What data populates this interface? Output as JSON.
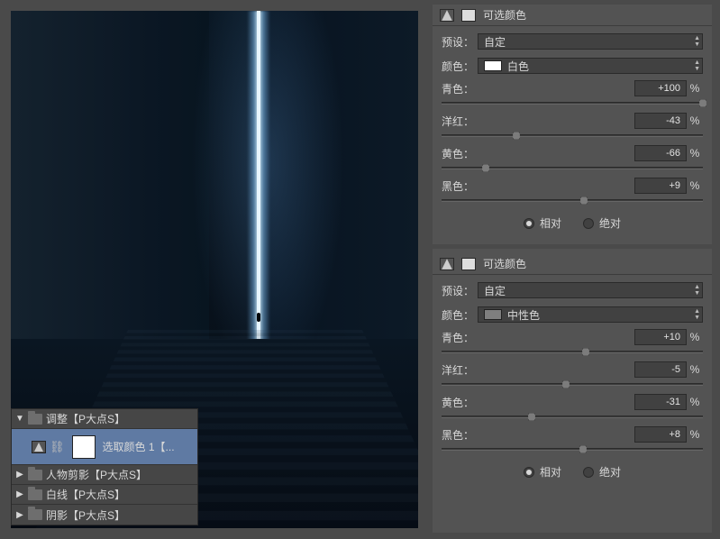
{
  "layers": {
    "group": "调整【P大点S】",
    "selected": "选取颜色 1【...",
    "items": [
      "人物剪影【P大点S】",
      "白线【P大点S】",
      "阴影【P大点S】"
    ]
  },
  "panels": [
    {
      "title": "可选颜色",
      "preset_label": "预设：",
      "preset_value": "自定",
      "color_label": "颜色：",
      "color_value": "白色",
      "color_swatch": "#ffffff",
      "sliders": [
        {
          "label": "青色：",
          "value": "+100",
          "pos": 100
        },
        {
          "label": "洋红：",
          "value": "-43",
          "pos": 28.5
        },
        {
          "label": "黄色：",
          "value": "-66",
          "pos": 17
        },
        {
          "label": "黑色：",
          "value": "+9",
          "pos": 54.5
        }
      ],
      "method": {
        "relative": "相对",
        "absolute": "绝对",
        "selected": "relative"
      }
    },
    {
      "title": "可选颜色",
      "preset_label": "预设：",
      "preset_value": "自定",
      "color_label": "颜色：",
      "color_value": "中性色",
      "color_swatch": "#7f7f7f",
      "sliders": [
        {
          "label": "青色：",
          "value": "+10",
          "pos": 55
        },
        {
          "label": "洋红：",
          "value": "-5",
          "pos": 47.5
        },
        {
          "label": "黄色：",
          "value": "-31",
          "pos": 34.5
        },
        {
          "label": "黑色：",
          "value": "+8",
          "pos": 54
        }
      ],
      "method": {
        "relative": "相对",
        "absolute": "绝对",
        "selected": "relative"
      }
    }
  ],
  "percent": "%"
}
